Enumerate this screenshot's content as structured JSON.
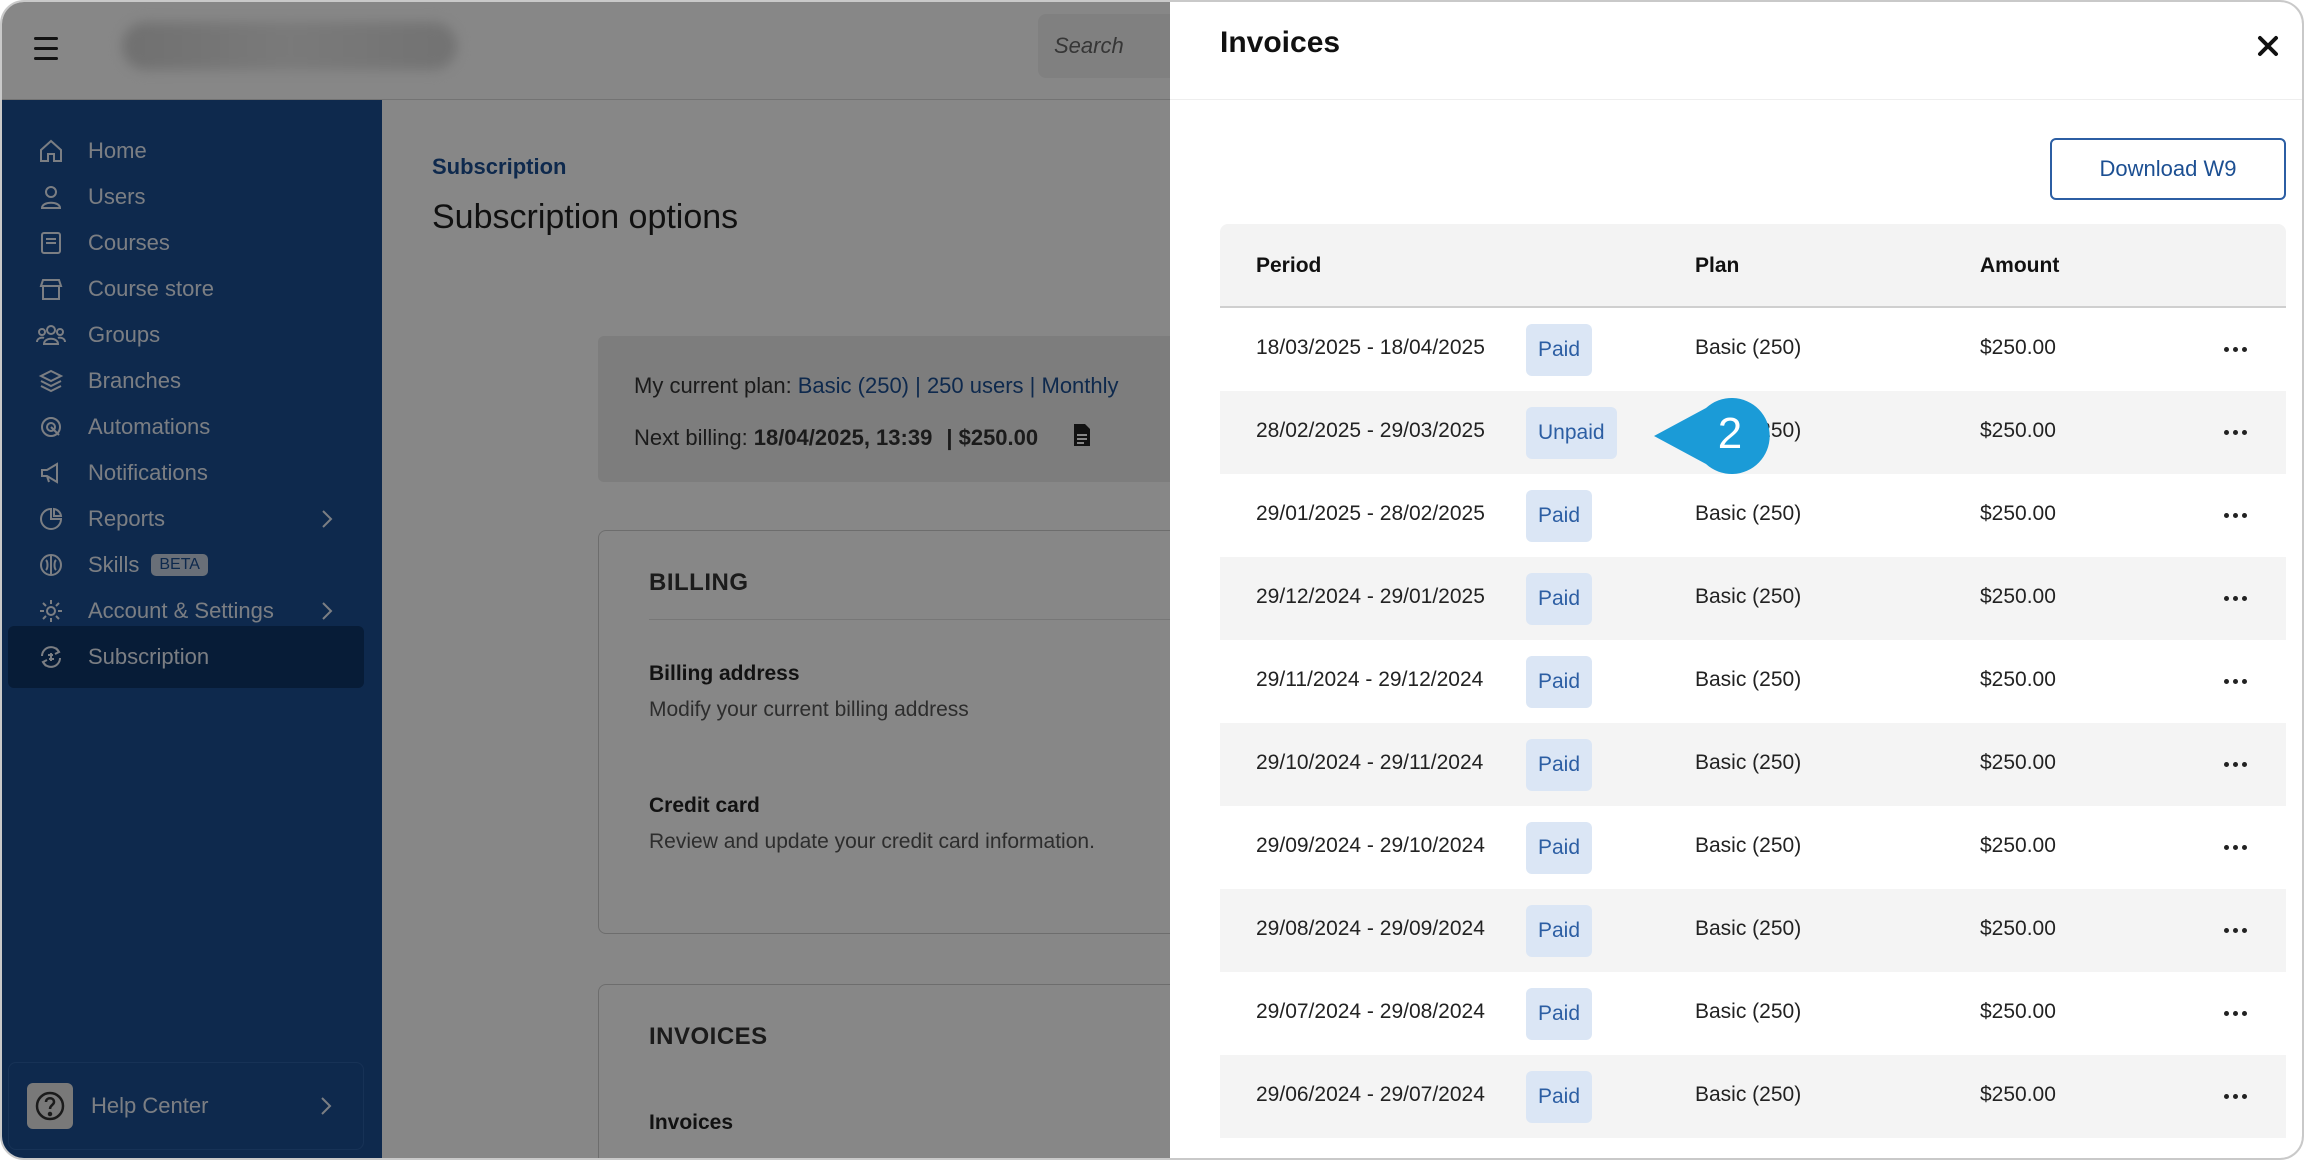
{
  "topbar": {
    "search_placeholder": "Search"
  },
  "sidebar": {
    "items": [
      {
        "label": "Home",
        "icon": "home-icon"
      },
      {
        "label": "Users",
        "icon": "user-icon"
      },
      {
        "label": "Courses",
        "icon": "book-icon"
      },
      {
        "label": "Course store",
        "icon": "store-icon"
      },
      {
        "label": "Groups",
        "icon": "groups-icon"
      },
      {
        "label": "Branches",
        "icon": "layers-icon"
      },
      {
        "label": "Automations",
        "icon": "automation-icon"
      },
      {
        "label": "Notifications",
        "icon": "megaphone-icon"
      },
      {
        "label": "Reports",
        "icon": "pie-chart-icon"
      },
      {
        "label": "Skills",
        "icon": "brain-icon",
        "badge": "BETA"
      },
      {
        "label": "Account & Settings",
        "icon": "gear-icon"
      },
      {
        "label": "Subscription",
        "icon": "subscription-icon",
        "active": true
      }
    ],
    "help_label": "Help Center"
  },
  "main": {
    "breadcrumb": "Subscription",
    "title": "Subscription options",
    "plan": {
      "current_label": "My current plan:",
      "current_value": "Basic (250) | 250 users | Monthly",
      "next_label": "Next billing:",
      "next_value": "18/04/2025, 13:39",
      "next_amount": "| $250.00"
    },
    "billing": {
      "heading": "BILLING",
      "address_title": "Billing address",
      "address_desc": "Modify your current billing address",
      "card_title": "Credit card",
      "card_desc": "Review and update your credit card information."
    },
    "invoices_card": {
      "heading": "INVOICES",
      "item_title": "Invoices"
    }
  },
  "drawer": {
    "title": "Invoices",
    "download_w9": "Download W9",
    "columns": {
      "period": "Period",
      "plan": "Plan",
      "amount": "Amount"
    },
    "rows": [
      {
        "period": "18/03/2025 - 18/04/2025",
        "status": "Paid",
        "plan": "Basic (250)",
        "amount": "$250.00"
      },
      {
        "period": "28/02/2025 - 29/03/2025",
        "status": "Unpaid",
        "plan": "Basic (250)",
        "amount": "$250.00"
      },
      {
        "period": "29/01/2025 - 28/02/2025",
        "status": "Paid",
        "plan": "Basic (250)",
        "amount": "$250.00"
      },
      {
        "period": "29/12/2024 - 29/01/2025",
        "status": "Paid",
        "plan": "Basic (250)",
        "amount": "$250.00"
      },
      {
        "period": "29/11/2024 - 29/12/2024",
        "status": "Paid",
        "plan": "Basic (250)",
        "amount": "$250.00"
      },
      {
        "period": "29/10/2024 - 29/11/2024",
        "status": "Paid",
        "plan": "Basic (250)",
        "amount": "$250.00"
      },
      {
        "period": "29/09/2024 - 29/10/2024",
        "status": "Paid",
        "plan": "Basic (250)",
        "amount": "$250.00"
      },
      {
        "period": "29/08/2024 - 29/09/2024",
        "status": "Paid",
        "plan": "Basic (250)",
        "amount": "$250.00"
      },
      {
        "period": "29/07/2024 - 29/08/2024",
        "status": "Paid",
        "plan": "Basic (250)",
        "amount": "$250.00"
      },
      {
        "period": "29/06/2024 - 29/07/2024",
        "status": "Paid",
        "plan": "Basic (250)",
        "amount": "$250.00"
      }
    ]
  },
  "callout": {
    "number": "2",
    "color": "#1b9bd7"
  },
  "colors": {
    "sidebar": "#1c4f92",
    "accent": "#1c4f92",
    "badge_bg": "#dbe6f5"
  }
}
